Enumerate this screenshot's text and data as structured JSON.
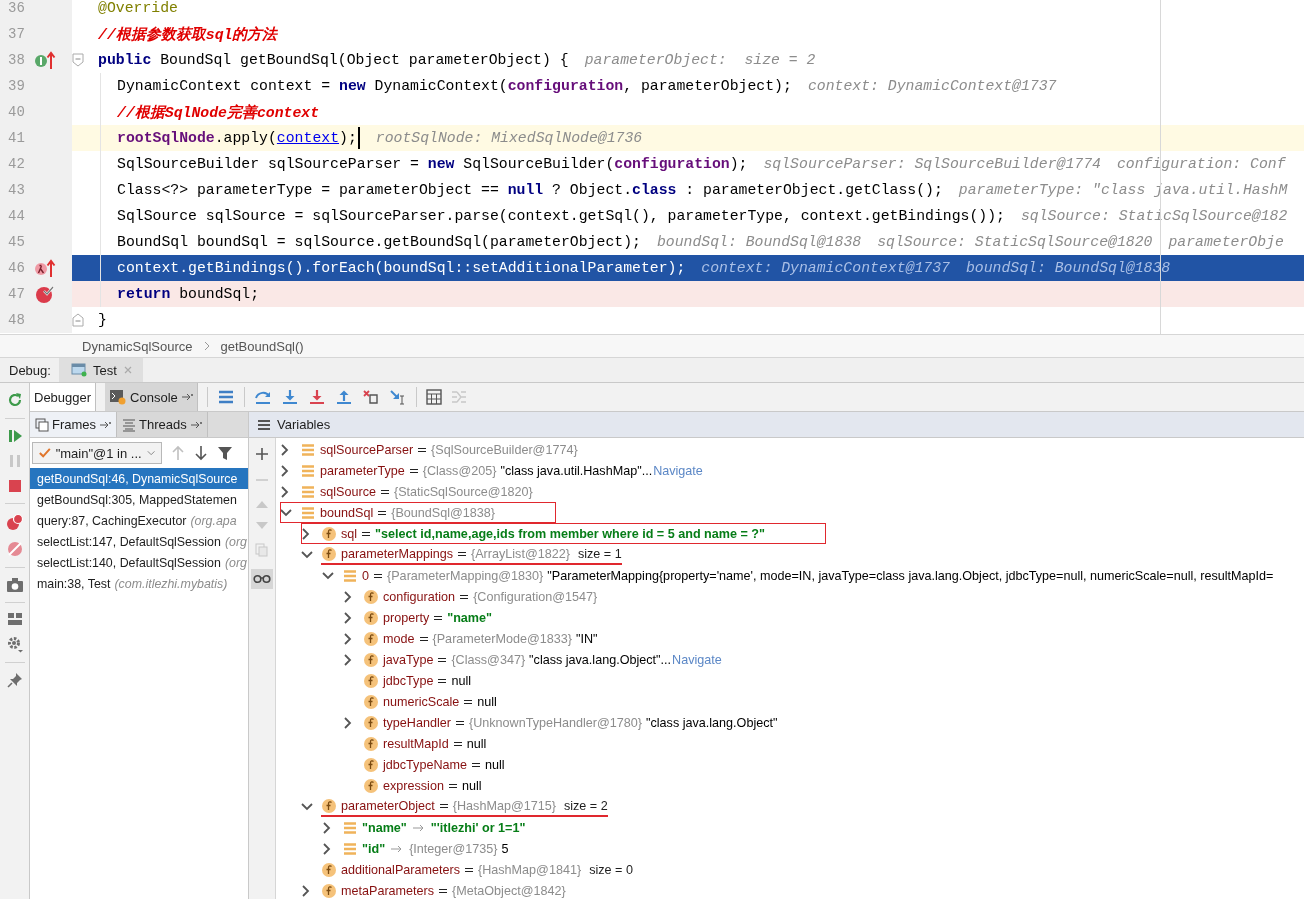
{
  "editor": {
    "lines": [
      {
        "number": "36",
        "indented": false,
        "selected": false,
        "tokens": [
          {
            "kind": "annotation",
            "t": "@Override"
          }
        ]
      },
      {
        "number": "37",
        "indented": false,
        "selected": false,
        "tokens": [
          {
            "kind": "comment",
            "t": "//根据参数获取sql的方法"
          }
        ]
      },
      {
        "number": "38",
        "indented": false,
        "selected": false,
        "marker": {
          "kind": "implements"
        },
        "fold": {
          "kind": "start"
        },
        "tokens": [
          {
            "kind": "keyword",
            "t": "public"
          },
          {
            "kind": "plain",
            "t": " BoundSql getBoundSql(Object parameterObject) {"
          }
        ],
        "hints": [
          "parameterObject:  size = 2"
        ]
      },
      {
        "number": "39",
        "indented": true,
        "selected": false,
        "tokens": [
          {
            "kind": "plain",
            "t": "DynamicContext context = "
          },
          {
            "kind": "keyword",
            "t": "new"
          },
          {
            "kind": "plain",
            "t": " DynamicContext("
          },
          {
            "kind": "field",
            "t": "configuration"
          },
          {
            "kind": "plain",
            "t": ", parameterObject);"
          }
        ],
        "hints": [
          "context: DynamicContext@1737"
        ]
      },
      {
        "number": "40",
        "indented": true,
        "selected": false,
        "tokens": [
          {
            "kind": "comment",
            "t": "//根据SqlNode完善context"
          }
        ]
      },
      {
        "number": "41",
        "indented": true,
        "selected": false,
        "current": true,
        "tokens": [
          {
            "kind": "field",
            "t": "rootSqlNode"
          },
          {
            "kind": "plain",
            "t": ".apply("
          },
          {
            "kind": "link",
            "t": "context"
          },
          {
            "kind": "plain",
            "t": ");"
          }
        ],
        "hints": [
          "rootSqlNode: MixedSqlNode@1736"
        ]
      },
      {
        "number": "42",
        "indented": true,
        "selected": false,
        "tokens": [
          {
            "kind": "plain",
            "t": "SqlSourceBuilder sqlSourceParser = "
          },
          {
            "kind": "keyword",
            "t": "new"
          },
          {
            "kind": "plain",
            "t": " SqlSourceBuilder("
          },
          {
            "kind": "field",
            "t": "configuration"
          },
          {
            "kind": "plain",
            "t": ");"
          }
        ],
        "hints": [
          "sqlSourceParser: SqlSourceBuilder@1774",
          "configuration: Conf"
        ]
      },
      {
        "number": "43",
        "indented": true,
        "selected": false,
        "tokens": [
          {
            "kind": "plain",
            "t": "Class<?> parameterType = parameterObject == "
          },
          {
            "kind": "keyword",
            "t": "null"
          },
          {
            "kind": "plain",
            "t": " ? Object."
          },
          {
            "kind": "keyword",
            "t": "class"
          },
          {
            "kind": "plain",
            "t": " : parameterObject.getClass();"
          }
        ],
        "hints": [
          "parameterType: \"class java.util.HashM"
        ]
      },
      {
        "number": "44",
        "indented": true,
        "selected": false,
        "tokens": [
          {
            "kind": "plain",
            "t": "SqlSource sqlSource = sqlSourceParser.parse(context.getSql(), parameterType, context.getBindings());"
          }
        ],
        "hints": [
          "sqlSource: StaticSqlSource@182"
        ]
      },
      {
        "number": "45",
        "indented": true,
        "selected": false,
        "tokens": [
          {
            "kind": "plain",
            "t": "BoundSql boundSql = sqlSource.getBoundSql(parameterObject);"
          }
        ],
        "hints": [
          "boundSql: BoundSql@1838",
          "sqlSource: StaticSqlSource@1820",
          "parameterObje"
        ]
      },
      {
        "number": "46",
        "indented": true,
        "selected": true,
        "marker": {
          "kind": "lambda"
        },
        "tokens": [
          {
            "kind": "plain",
            "t": "context.getBindings().forEach(boundSql::setAdditionalParameter);"
          }
        ],
        "hints": [
          "context: DynamicContext@1737",
          "boundSql: BoundSql@1838"
        ]
      },
      {
        "number": "47",
        "indented": true,
        "selected": false,
        "breakpoint": true,
        "tokens": [
          {
            "kind": "keyword",
            "t": "return"
          },
          {
            "kind": "plain",
            "t": " boundSql;"
          }
        ]
      },
      {
        "number": "48",
        "indented": false,
        "selected": false,
        "fold": {
          "kind": "end"
        },
        "tokens": [
          {
            "kind": "plain",
            "t": "}"
          }
        ]
      }
    ]
  },
  "breadcrumb": [
    "DynamicSqlSource",
    "getBoundSql()"
  ],
  "debug_bar": {
    "label": "Debug:",
    "tab": "Test"
  },
  "tool_tabs": [
    {
      "label": "Debugger",
      "selected": true
    },
    {
      "label": "Console",
      "selected": false
    }
  ],
  "frames_panel": {
    "tabs": [
      {
        "label": "Frames",
        "selected": true
      },
      {
        "label": "Threads",
        "selected": false
      }
    ],
    "thread": "\"main\"@1 in ...",
    "frames": [
      {
        "method": "getBoundSql:46, DynamicSqlSource",
        "selected": true
      },
      {
        "method": "getBoundSql:305, MappedStatemen",
        "selected": false
      },
      {
        "method": "query:87, CachingExecutor",
        "package": "(org.apa",
        "selected": false
      },
      {
        "method": "selectList:147, DefaultSqlSession",
        "package": "(org",
        "selected": false
      },
      {
        "method": "selectList:140, DefaultSqlSession",
        "package": "(org",
        "selected": false
      },
      {
        "method": "main:38, Test",
        "package": "(com.itlezhi.mybatis)",
        "selected": false
      }
    ]
  },
  "variables": {
    "title": "Variables",
    "items": [
      {
        "name": "sqlSourceParser",
        "kind": "local",
        "expanded": false,
        "ref": "{SqlSourceBuilder@1774}"
      },
      {
        "name": "parameterType",
        "kind": "local",
        "expanded": false,
        "ref": "{Class@205}",
        "value": "\"class java.util.HashMap\"...",
        "link": "Navigate"
      },
      {
        "name": "sqlSource",
        "kind": "local",
        "expanded": false,
        "ref": "{StaticSqlSource@1820}"
      },
      {
        "name": "boundSql",
        "kind": "local",
        "expanded": true,
        "ref": "{BoundSql@1838}",
        "boxed": true,
        "children": [
          {
            "name": "sql",
            "kind": "field",
            "expanded": false,
            "value": "\"select id,name,age,ids from member where id = 5 and name = ?\"",
            "string": true,
            "boxed": true
          },
          {
            "name": "parameterMappings",
            "kind": "field",
            "expanded": true,
            "ref": "{ArrayList@1822}",
            "suffix": "size = 1",
            "underlined": true,
            "children": [
              {
                "name": "0",
                "kind": "local",
                "expanded": true,
                "ref": "{ParameterMapping@1830}",
                "value": "\"ParameterMapping{property='name', mode=IN, javaType=class java.lang.Object, jdbcType=null, numericScale=null, resultMapId=",
                "children": [
                  {
                    "name": "configuration",
                    "kind": "field",
                    "expanded": false,
                    "ref": "{Configuration@1547}"
                  },
                  {
                    "name": "property",
                    "kind": "field",
                    "expanded": false,
                    "value": "\"name\"",
                    "string": true
                  },
                  {
                    "name": "mode",
                    "kind": "field",
                    "expanded": false,
                    "ref": "{ParameterMode@1833}",
                    "value": "\"IN\""
                  },
                  {
                    "name": "javaType",
                    "kind": "field",
                    "expanded": false,
                    "ref": "{Class@347}",
                    "value": "\"class java.lang.Object\"...",
                    "link": "Navigate"
                  },
                  {
                    "name": "jdbcType",
                    "kind": "field",
                    "value": "null"
                  },
                  {
                    "name": "numericScale",
                    "kind": "field",
                    "value": "null"
                  },
                  {
                    "name": "typeHandler",
                    "kind": "field",
                    "expanded": false,
                    "ref": "{UnknownTypeHandler@1780}",
                    "value": "\"class java.lang.Object\""
                  },
                  {
                    "name": "resultMapId",
                    "kind": "field",
                    "value": "null"
                  },
                  {
                    "name": "jdbcTypeName",
                    "kind": "field",
                    "value": "null"
                  },
                  {
                    "name": "expression",
                    "kind": "field",
                    "value": "null"
                  }
                ]
              }
            ]
          },
          {
            "name": "parameterObject",
            "kind": "field",
            "expanded": true,
            "ref": "{HashMap@1715}",
            "suffix": "size = 2",
            "underlined": true,
            "children": [
              {
                "name": "\"name\"",
                "kind": "entry",
                "expanded": false,
                "value": "\"'itlezhi' or 1=1\"",
                "string": true
              },
              {
                "name": "\"id\"",
                "kind": "entry",
                "expanded": false,
                "ref": "{Integer@1735}",
                "value": "5"
              }
            ]
          },
          {
            "name": "additionalParameters",
            "kind": "field",
            "ref": "{HashMap@1841}",
            "suffix": "size = 0"
          },
          {
            "name": "metaParameters",
            "kind": "field",
            "expanded": false,
            "ref": "{MetaObject@1842}"
          }
        ]
      }
    ]
  }
}
